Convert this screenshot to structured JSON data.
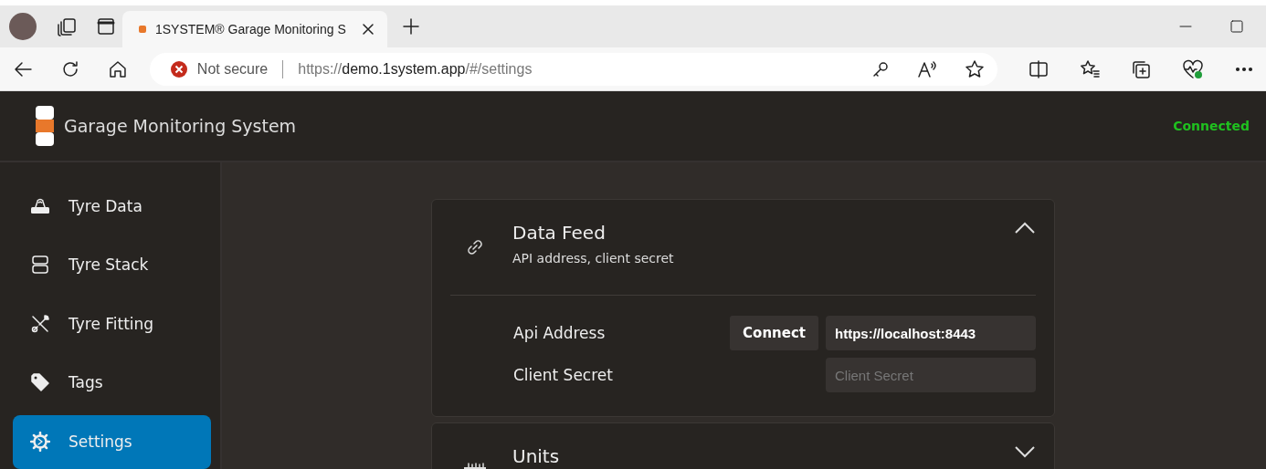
{
  "browser": {
    "tab": {
      "title": "1SYSTEM® Garage Monitoring S",
      "selected": true
    },
    "security": "Not secure",
    "url": {
      "scheme": "https://",
      "host": "demo.1system.app",
      "path": "/#/settings"
    }
  },
  "app": {
    "title": "Garage Monitoring System",
    "status": "Connected"
  },
  "sidebar": {
    "items": [
      {
        "label": "Tyre Data",
        "selected": false
      },
      {
        "label": "Tyre Stack",
        "selected": false
      },
      {
        "label": "Tyre Fitting",
        "selected": false
      },
      {
        "label": "Tags",
        "selected": false
      },
      {
        "label": "Settings",
        "selected": true
      }
    ]
  },
  "sections": [
    {
      "title": "Data Feed",
      "subtitle": "API address, client secret",
      "expanded": true,
      "fields": [
        {
          "label": "Api Address",
          "button": "Connect",
          "value": "https://localhost:8443"
        },
        {
          "label": "Client Secret",
          "placeholder": "Client Secret"
        }
      ]
    },
    {
      "title": "Units",
      "expanded": false
    }
  ]
}
